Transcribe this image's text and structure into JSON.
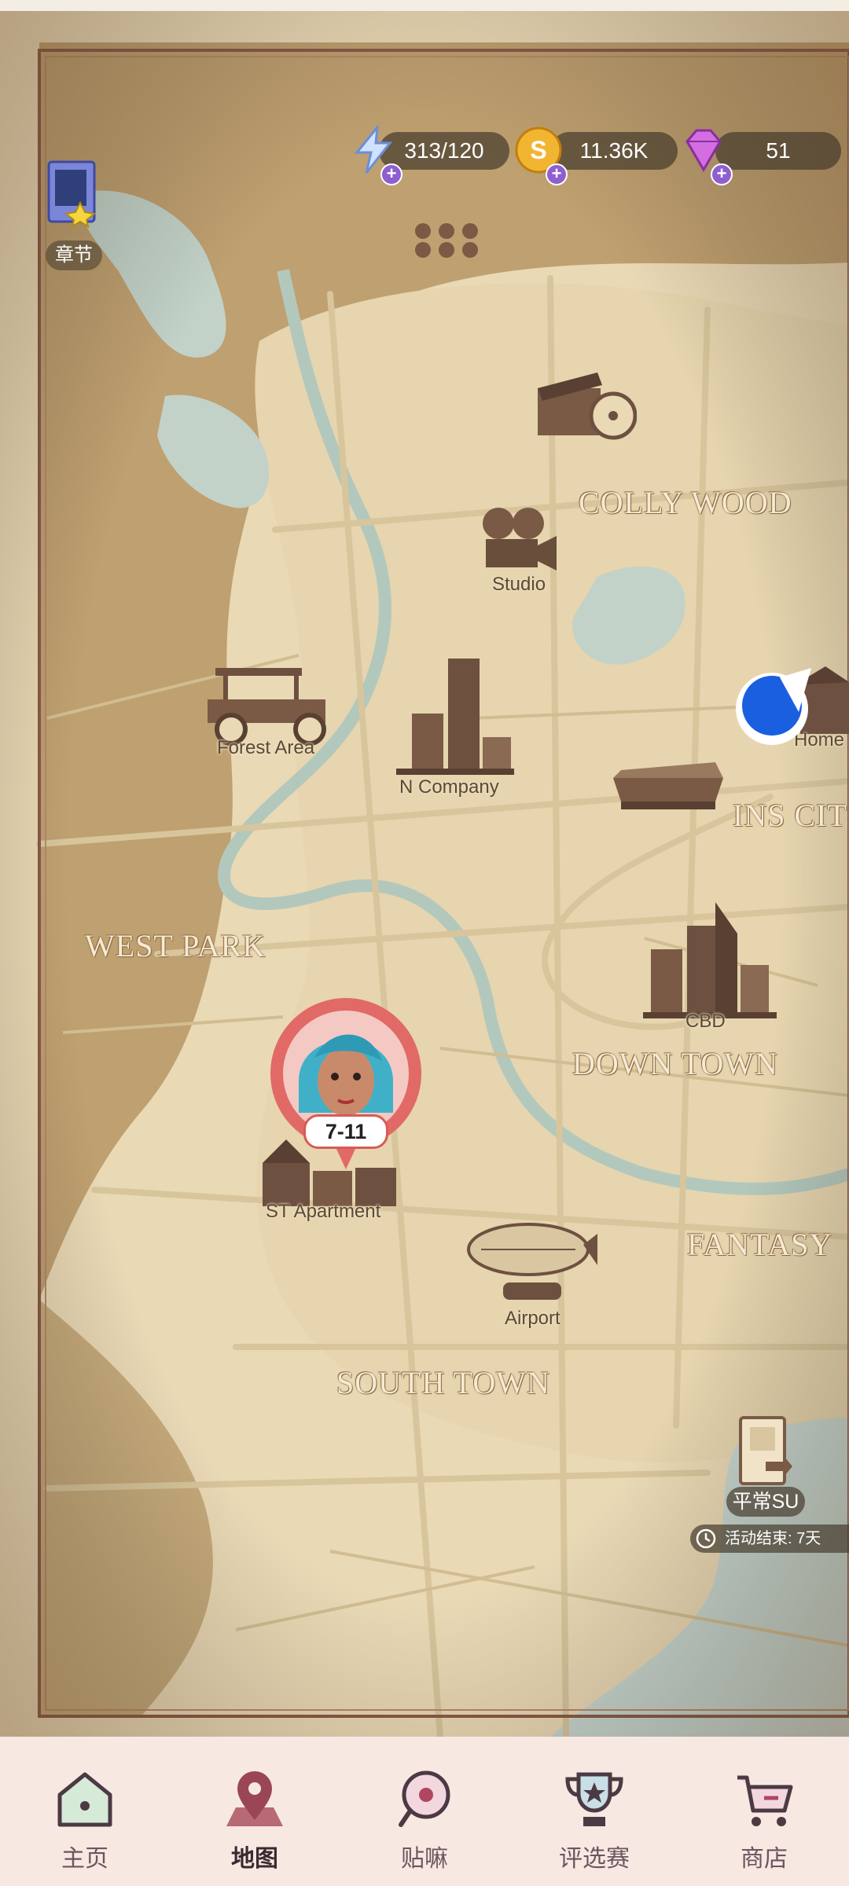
{
  "resources": {
    "energy": "313/120",
    "coins": "11.36K",
    "diamonds": "51"
  },
  "chapter": {
    "label": "章节"
  },
  "map": {
    "districts": {
      "colly_wood": "COLLY WOOD",
      "ins_city": "INS CIT",
      "west_park": "WEST PARK",
      "down_town": "DOWN TOWN",
      "fantasy": "FANTASY",
      "south_town": "SOUTH TOWN"
    },
    "places": {
      "studio": "Studio",
      "forest_area": "Forest Area",
      "n_company": "N Company",
      "home": "Home",
      "cbd": "CBD",
      "st_apartment": "ST Apartment",
      "airport": "Airport"
    },
    "current_stage": "7-11"
  },
  "event": {
    "name": "平常SU",
    "timer": "活动结束: 7天"
  },
  "nav": {
    "items": [
      {
        "label": "主页",
        "icon": "home-icon"
      },
      {
        "label": "地图",
        "icon": "map-pin-icon"
      },
      {
        "label": "贴嘛",
        "icon": "magnifier-icon"
      },
      {
        "label": "评选赛",
        "icon": "trophy-icon"
      },
      {
        "label": "商店",
        "icon": "cart-icon"
      }
    ],
    "active": "地图"
  },
  "colors": {
    "map_base": "#e7d6b2",
    "map_land": "#bfa274",
    "river": "#b8ccc1",
    "nav_bg": "#f7e9e2",
    "marker_red": "#e16a66",
    "accent_blue": "#1a5fe0"
  }
}
